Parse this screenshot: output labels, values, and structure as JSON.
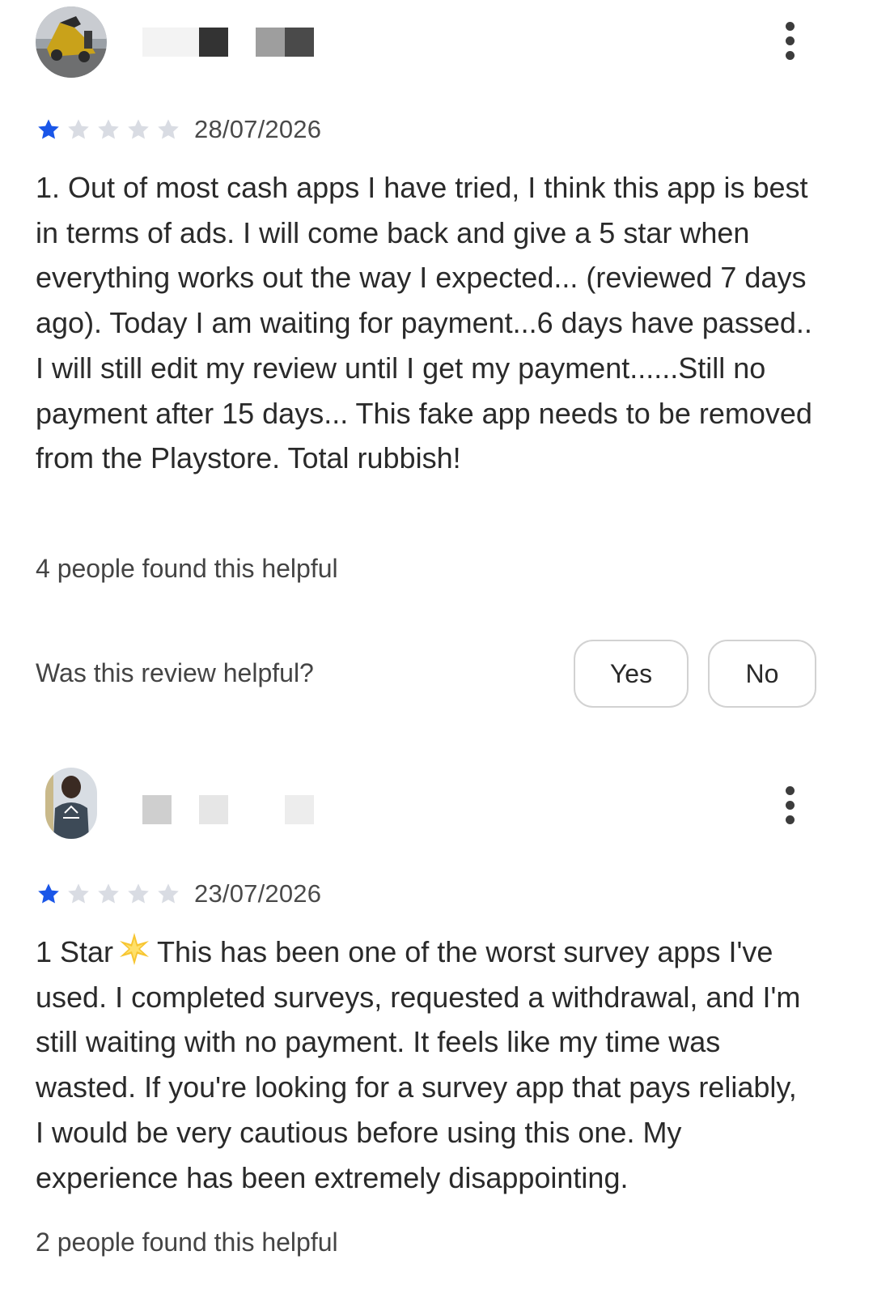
{
  "colors": {
    "star_filled": "#1a56e8",
    "star_empty": "#d9dce3",
    "text_primary": "#2a2a2a",
    "text_secondary": "#444444",
    "button_border": "#d2d2d2"
  },
  "reviews": [
    {
      "avatar_icon": "avatar-image-vehicle",
      "rating": 1,
      "max_rating": 5,
      "date": "28/07/2026",
      "text": "1. Out of most cash apps I have tried, I think this app is best in terms of ads. I will come back and give a 5 star when everything works out the way I expected... (reviewed 7 days ago). Today I am waiting for payment...6 days have passed.. I will still edit my review until I get my payment......Still no payment after 15 days... This fake app needs to be removed from the Playstore. Total rubbish!",
      "helpful_count_text": "4 people found this helpful",
      "helpful_question": "Was this review helpful?",
      "yes_label": "Yes",
      "no_label": "No",
      "more_icon": "more-vert-icon"
    },
    {
      "avatar_icon": "avatar-image-person",
      "rating": 1,
      "max_rating": 5,
      "date": "23/07/2026",
      "text_before_emoji": "1 Star",
      "emoji_icon": "sparkle-star-icon",
      "text_after_emoji": "This has been one of the worst survey apps I've used. I completed surveys, requested a withdrawal, and I'm still waiting with no payment. It feels like my time was wasted. If you're looking for a survey app that pays reliably, I would be very cautious before using this one. My experience has been extremely disappointing.",
      "helpful_count_text": "2 people found this helpful",
      "more_icon": "more-vert-icon"
    }
  ]
}
